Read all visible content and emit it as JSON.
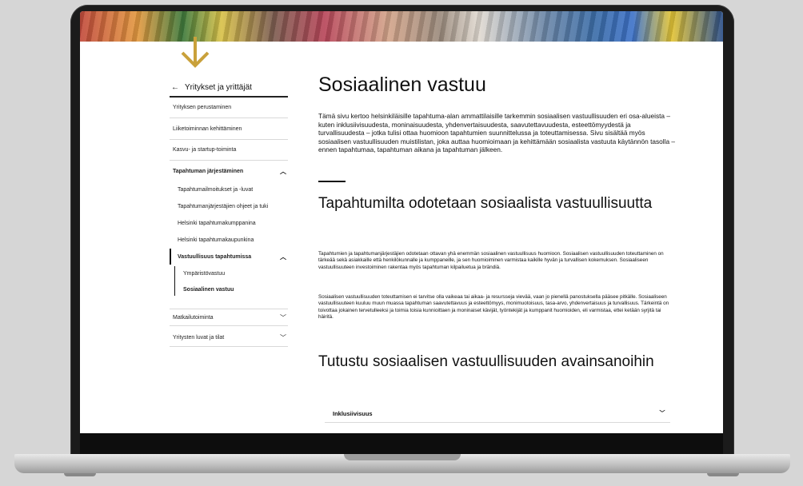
{
  "sidebar": {
    "back_label": "Yritykset ja yrittäjät",
    "items": [
      {
        "label": "Yrityksen perustaminen"
      },
      {
        "label": "Liiketoiminnan kehittäminen"
      },
      {
        "label": "Kasvu- ja startup-toiminta"
      },
      {
        "label": "Tapahtuman järjestäminen",
        "expanded": true
      },
      {
        "label": "Tapahtumailmoitukset ja -luvat"
      },
      {
        "label": "Tapahtumanjärjestäjien ohjeet ja tuki"
      },
      {
        "label": "Helsinki tapahtumakumppanina"
      },
      {
        "label": "Helsinki tapahtumakaupunkina"
      },
      {
        "label": "Vastuullisuus tapahtumissa",
        "expanded": true
      },
      {
        "label": "Ympäristövastuu"
      },
      {
        "label": "Sosiaalinen vastuu",
        "current": true
      },
      {
        "label": "Matkailutoiminta",
        "expanded": false
      },
      {
        "label": "Yritysten luvat ja tilat",
        "expanded": false
      }
    ]
  },
  "main": {
    "title": "Sosiaalinen vastuu",
    "lead": "Tämä sivu kertoo helsinkiläisille tapahtuma-alan ammattilaisille tarkemmin sosiaalisen vastuullisuuden eri osa-alueista –kuten inklusiivisuudesta, moninaisuudesta, yhdenvertaisuudesta, saavutettavuudesta, esteettömyydestä ja turvallisuudesta – jotka tulisi ottaa huomioon tapahtumien suunnittelussa ja toteuttamisessa. Sivu sisältää myös sosiaalisen vastuullisuuden muistilistan, joka auttaa huomioimaan ja kehittämään sosiaalista vastuuta käytännön tasolla – ennen tapahtumaa, tapahtuman aikana ja tapahtuman jälkeen.",
    "section1_heading": "Tapahtumilta odotetaan sosiaalista vastuullisuutta",
    "section1_p1": "Tapahtumien ja tapahtumanjärjestäjien odotetaan ottavan yhä enemmän sosiaalinen vastuullisuus huomioon. Sosiaalisen vastuullisuuden toteuttaminen on tärkeää sekä asiakkaille että henkilökunnalle ja kumppaneille, ja sen huomioiminen varmistaa kaikille hyvän ja turvallisen kokemuksen. Sosiaaliseen vastuullisuuteen investoiminen rakentaa myös tapahtuman kilpailuetua ja brändiä.",
    "section1_p2": "Sosiaalisen vastuullisuuden toteuttamisen ei tarvitse olla vaikeaa tai aikaa- ja resursseja vievää, vaan jo pienellä panostuksella pääsee pitkälle. Sosiaaliseen vastuullisuuteen kuuluu muun muassa tapahtuman saavutettavuus ja esteettömyys, monimuotoisuus, tasa-arvo, yhdenvertaisuus ja turvallisuus. Tärkeintä on toivottaa jokainen tervetulleeksi ja toimia toisia kunnioittaen ja moninaiset kävijät, työntekijät ja kumppanit huomioiden, eli varmistaa, ettei ketään syrjitä tai häiritä.",
    "section2_heading": "Tutustu sosiaalisen vastuullisuuden avainsanoihin",
    "accordion": {
      "label": "Inklusiivisuus"
    }
  },
  "icons": {
    "arrow": "arrow-down-icon",
    "back": "arrow-left-icon",
    "chevron_up": "chevron-up-icon",
    "chevron_down": "chevron-down-icon"
  },
  "colors": {
    "arrow": "#c9a13b",
    "text": "#111111",
    "background": "#d6d6d6"
  }
}
